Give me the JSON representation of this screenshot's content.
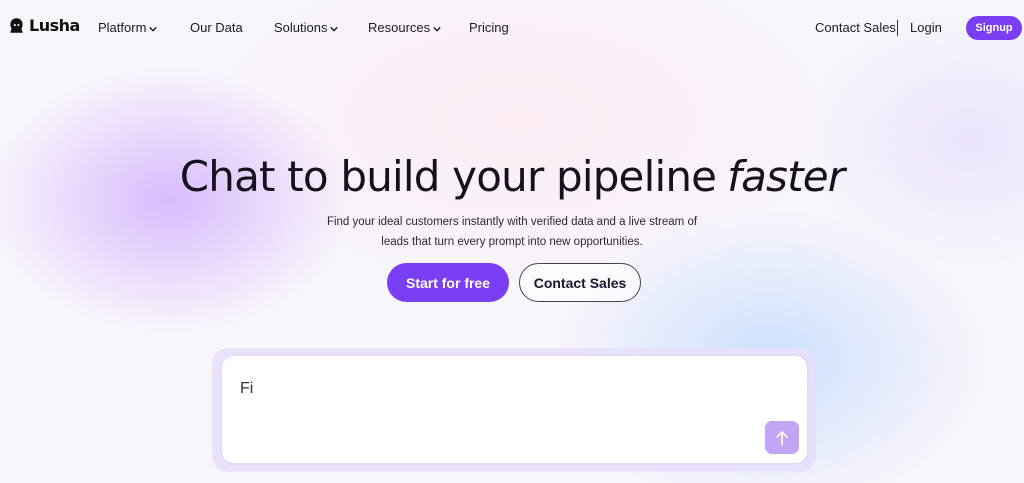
{
  "brand": {
    "name": "Lusha",
    "accent": "#7a3ff5"
  },
  "nav": {
    "items": [
      {
        "label": "Platform",
        "dropdown": true
      },
      {
        "label": "Our Data",
        "dropdown": false
      },
      {
        "label": "Solutions",
        "dropdown": true
      },
      {
        "label": "Resources",
        "dropdown": true
      },
      {
        "label": "Pricing",
        "dropdown": false
      }
    ],
    "contact_sales": "Contact Sales",
    "login": "Login",
    "signup": "Signup"
  },
  "hero": {
    "title_main": "Chat to build your pipeline",
    "title_emphasis": "faster",
    "subtitle_line1": "Find your ideal customers instantly with verified data and a live stream of",
    "subtitle_line2": "leads that turn every prompt into new opportunities.",
    "primary_cta": "Start for free",
    "secondary_cta": "Contact Sales"
  },
  "chat": {
    "input_value": "Fi",
    "send_icon": "arrow-up-icon"
  }
}
